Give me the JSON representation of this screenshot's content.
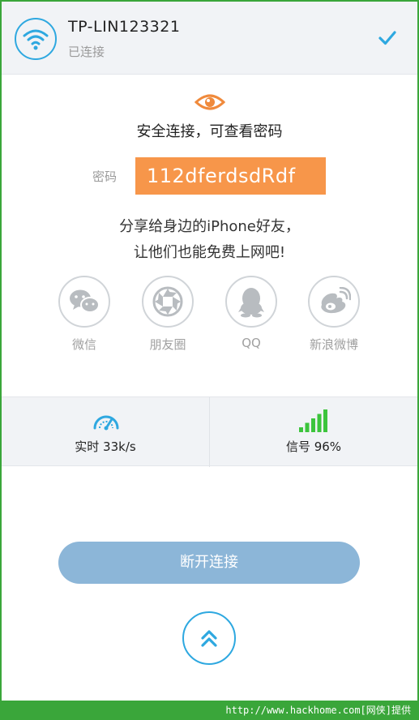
{
  "header": {
    "network_name": "TP-LIN123321",
    "status": "已连接"
  },
  "secure": {
    "title": "安全连接，可查看密码",
    "password_label": "密码",
    "password_value": "112dferdsdRdf"
  },
  "share": {
    "line1": "分享给身边的iPhone好友，",
    "line2": "让他们也能免费上网吧!",
    "items": [
      {
        "label": "微信",
        "icon": "wechat-icon"
      },
      {
        "label": "朋友圈",
        "icon": "moments-icon"
      },
      {
        "label": "QQ",
        "icon": "qq-icon"
      },
      {
        "label": "新浪微博",
        "icon": "weibo-icon"
      }
    ]
  },
  "stats": {
    "speed": "实时 33k/s",
    "signal": "信号 96%",
    "signal_level": 0.96
  },
  "actions": {
    "disconnect_label": "断开连接"
  },
  "footer": {
    "watermark": "http://www.hackhome.com[网侠]提供"
  },
  "colors": {
    "accent_blue": "#2ea8e0",
    "password_orange": "#f7964a",
    "signal_green": "#3cc43c",
    "button_blue": "#8cb6d8"
  }
}
